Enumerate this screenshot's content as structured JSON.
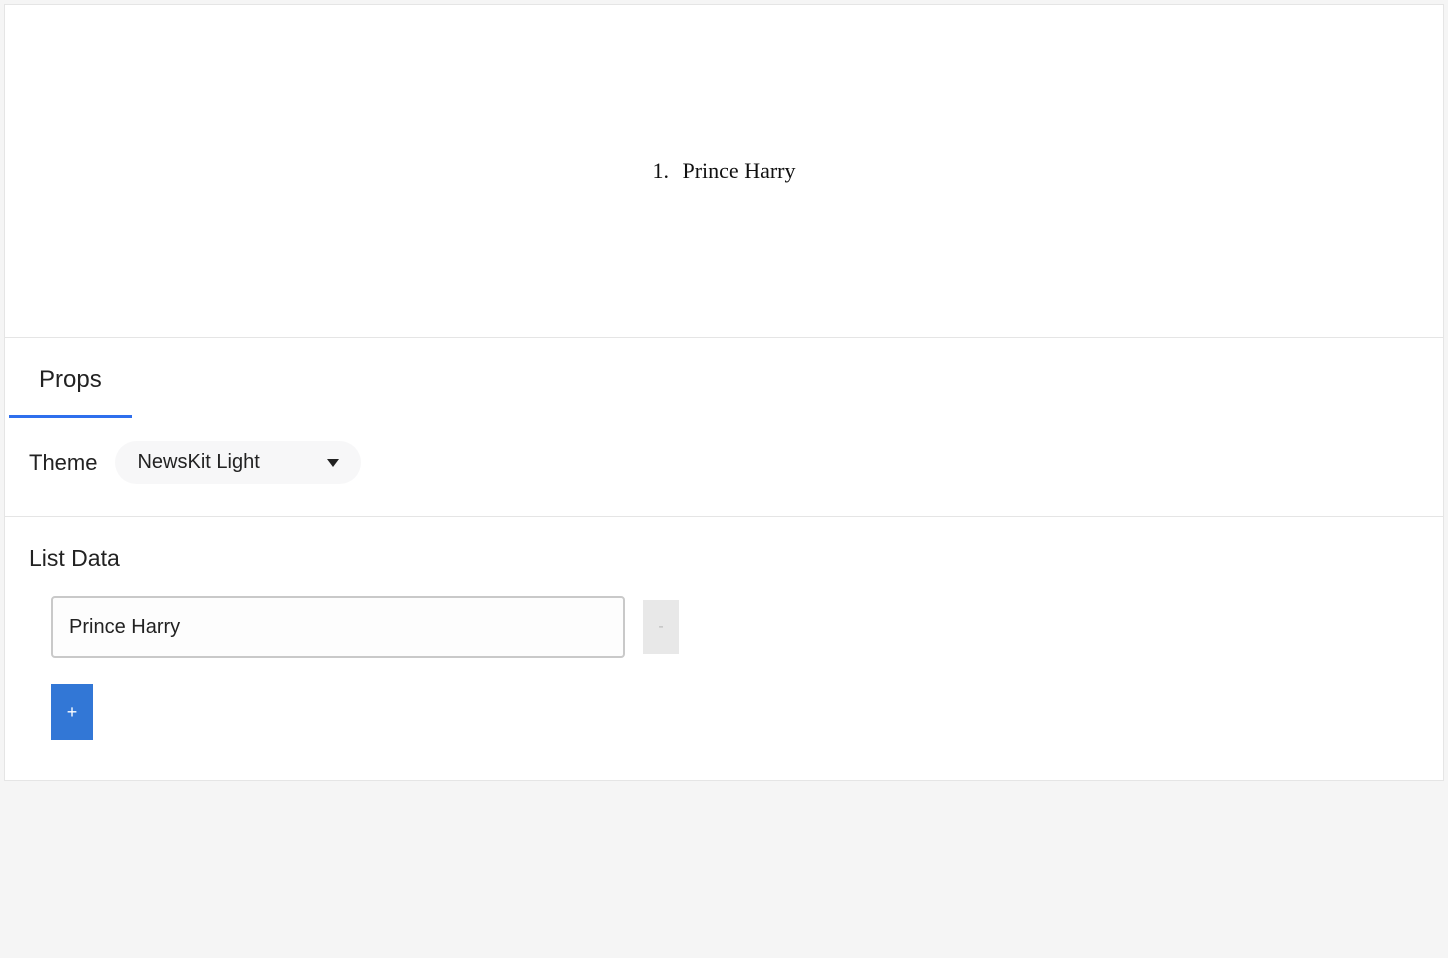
{
  "preview": {
    "marker": "1.",
    "text": "Prince Harry"
  },
  "tabs": {
    "props_label": "Props"
  },
  "theme": {
    "label": "Theme",
    "selected": "NewsKit Light"
  },
  "listdata": {
    "title": "List Data",
    "items": [
      {
        "value": "Prince Harry"
      }
    ],
    "remove_label": "-",
    "add_label": "+"
  }
}
